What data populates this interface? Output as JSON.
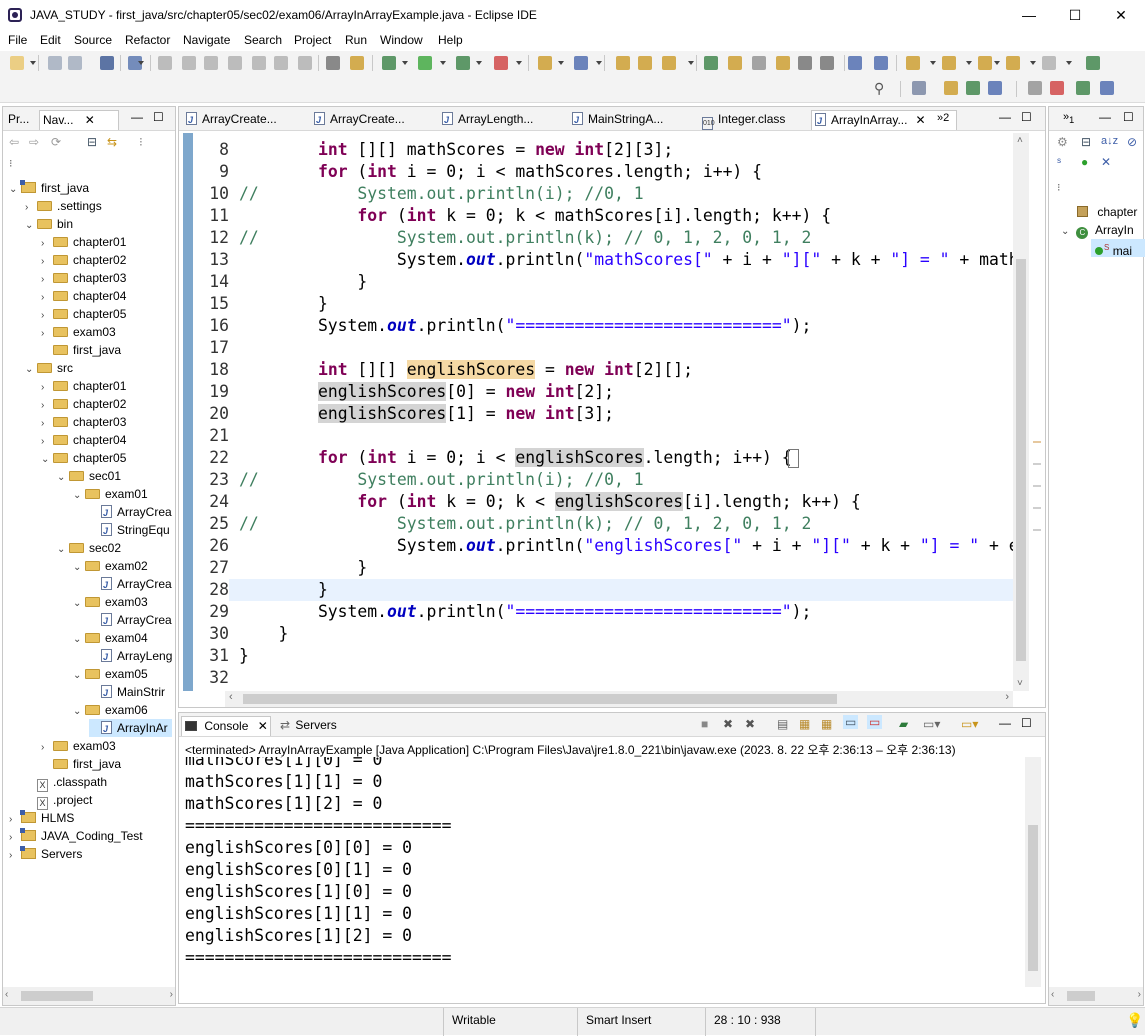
{
  "window": {
    "title": "JAVA_STUDY - first_java/src/chapter05/sec02/exam06/ArrayInArrayExample.java - Eclipse IDE",
    "minimize": "—",
    "maximize": "☐",
    "close": "✕"
  },
  "menu": [
    "File",
    "Edit",
    "Source",
    "Refactor",
    "Navigate",
    "Search",
    "Project",
    "Run",
    "Window",
    "Help"
  ],
  "left_panel": {
    "tabs": [
      {
        "label": "Pr..."
      },
      {
        "label": "Nav..."
      }
    ],
    "tree": [
      {
        "label": "first_java",
        "level": 0,
        "kind": "project",
        "expanded": true
      },
      {
        "label": ".settings",
        "level": 1,
        "kind": "folder",
        "expanded": false
      },
      {
        "label": "bin",
        "level": 1,
        "kind": "folder",
        "expanded": true
      },
      {
        "label": "chapter01",
        "level": 2,
        "kind": "folder",
        "expanded": false
      },
      {
        "label": "chapter02",
        "level": 2,
        "kind": "folder",
        "expanded": false
      },
      {
        "label": "chapter03",
        "level": 2,
        "kind": "folder",
        "expanded": false
      },
      {
        "label": "chapter04",
        "level": 2,
        "kind": "folder",
        "expanded": false
      },
      {
        "label": "chapter05",
        "level": 2,
        "kind": "folder",
        "expanded": false
      },
      {
        "label": "exam03",
        "level": 2,
        "kind": "folder",
        "expanded": false
      },
      {
        "label": "first_java",
        "level": 2,
        "kind": "folder",
        "expanded": null
      },
      {
        "label": "src",
        "level": 1,
        "kind": "folder",
        "expanded": true
      },
      {
        "label": "chapter01",
        "level": 2,
        "kind": "folder",
        "expanded": false
      },
      {
        "label": "chapter02",
        "level": 2,
        "kind": "folder",
        "expanded": false
      },
      {
        "label": "chapter03",
        "level": 2,
        "kind": "folder",
        "expanded": false
      },
      {
        "label": "chapter04",
        "level": 2,
        "kind": "folder",
        "expanded": false
      },
      {
        "label": "chapter05",
        "level": 2,
        "kind": "folder",
        "expanded": true
      },
      {
        "label": "sec01",
        "level": 3,
        "kind": "folder",
        "expanded": true
      },
      {
        "label": "exam01",
        "level": 4,
        "kind": "folder",
        "expanded": true
      },
      {
        "label": "ArrayCrea",
        "level": 5,
        "kind": "file",
        "expanded": null
      },
      {
        "label": "StringEqu",
        "level": 5,
        "kind": "file",
        "expanded": null
      },
      {
        "label": "sec02",
        "level": 3,
        "kind": "folder",
        "expanded": true
      },
      {
        "label": "exam02",
        "level": 4,
        "kind": "folder",
        "expanded": true
      },
      {
        "label": "ArrayCrea",
        "level": 5,
        "kind": "file",
        "expanded": null
      },
      {
        "label": "exam03",
        "level": 4,
        "kind": "folder",
        "expanded": true
      },
      {
        "label": "ArrayCrea",
        "level": 5,
        "kind": "file",
        "expanded": null
      },
      {
        "label": "exam04",
        "level": 4,
        "kind": "folder",
        "expanded": true
      },
      {
        "label": "ArrayLeng",
        "level": 5,
        "kind": "file",
        "expanded": null
      },
      {
        "label": "exam05",
        "level": 4,
        "kind": "folder",
        "expanded": true
      },
      {
        "label": "MainStrir",
        "level": 5,
        "kind": "file",
        "expanded": null
      },
      {
        "label": "exam06",
        "level": 4,
        "kind": "folder",
        "expanded": true
      },
      {
        "label": "ArrayInAr",
        "level": 5,
        "kind": "file",
        "expanded": null,
        "selected": true
      },
      {
        "label": "exam03",
        "level": 2,
        "kind": "folder",
        "expanded": false
      },
      {
        "label": "first_java",
        "level": 2,
        "kind": "folder",
        "expanded": null
      },
      {
        "label": ".classpath",
        "level": 1,
        "kind": "xml",
        "expanded": null
      },
      {
        "label": ".project",
        "level": 1,
        "kind": "xml",
        "expanded": null
      },
      {
        "label": "HLMS",
        "level": 0,
        "kind": "project",
        "expanded": false
      },
      {
        "label": "JAVA_Coding_Test",
        "level": 0,
        "kind": "project",
        "expanded": false
      },
      {
        "label": "Servers",
        "level": 0,
        "kind": "project",
        "expanded": false
      }
    ]
  },
  "editor": {
    "tabs": [
      {
        "label": "ArrayCreate...",
        "active": false
      },
      {
        "label": "ArrayCreate...",
        "active": false
      },
      {
        "label": "ArrayLength...",
        "active": false
      },
      {
        "label": "MainStringA...",
        "active": false
      },
      {
        "label": "Integer.class",
        "active": false
      },
      {
        "label": "ArrayInArray...",
        "active": true
      }
    ],
    "overflow_count": "»2",
    "first_line_number": 8,
    "lines": [
      [
        [
          "        ",
          ""
        ],
        [
          "int",
          "kw"
        ],
        [
          " []",
          ""
        ],
        [
          "[] mathScores = ",
          ""
        ],
        [
          "new",
          "kw"
        ],
        [
          " ",
          ""
        ],
        [
          "int",
          "kw"
        ],
        [
          "[2][3];",
          ""
        ]
      ],
      [
        [
          "        ",
          ""
        ],
        [
          "for",
          "kw"
        ],
        [
          " (",
          ""
        ],
        [
          "int",
          "kw"
        ],
        [
          " i = 0; i < mathScores.length; i++) {",
          ""
        ]
      ],
      [
        [
          "//          System.out.println(i); //0, 1",
          "cm"
        ]
      ],
      [
        [
          "            ",
          ""
        ],
        [
          "for",
          "kw"
        ],
        [
          " (",
          ""
        ],
        [
          "int",
          "kw"
        ],
        [
          " k = 0; k < mathScores[i].length; k++) {",
          ""
        ]
      ],
      [
        [
          "//              System.out.println(k); // 0, 1, 2, 0, 1, 2",
          "cm"
        ]
      ],
      [
        [
          "                System.",
          ""
        ],
        [
          "out",
          "fd"
        ],
        [
          ".println(",
          ""
        ],
        [
          "\"mathScores[\"",
          "st"
        ],
        [
          " + i + ",
          ""
        ],
        [
          "\"][\"",
          "st"
        ],
        [
          " + k + ",
          ""
        ],
        [
          "\"] = \"",
          "st"
        ],
        [
          " + math",
          ""
        ]
      ],
      [
        [
          "            }",
          ""
        ]
      ],
      [
        [
          "        }",
          ""
        ]
      ],
      [
        [
          "        System.",
          ""
        ],
        [
          "out",
          "fd"
        ],
        [
          ".println(",
          ""
        ],
        [
          "\"===========================\"",
          "st"
        ],
        [
          ");",
          ""
        ]
      ],
      [
        [
          "",
          ""
        ]
      ],
      [
        [
          "        ",
          ""
        ],
        [
          "int",
          "kw"
        ],
        [
          " [][] ",
          ""
        ],
        [
          "englishScores",
          "occw"
        ],
        [
          " = ",
          ""
        ],
        [
          "new",
          "kw"
        ],
        [
          " ",
          ""
        ],
        [
          "int",
          "kw"
        ],
        [
          "[2][];",
          ""
        ]
      ],
      [
        [
          "        ",
          ""
        ],
        [
          "englishScores",
          "occ"
        ],
        [
          "[0] = ",
          ""
        ],
        [
          "new",
          "kw"
        ],
        [
          " ",
          ""
        ],
        [
          "int",
          "kw"
        ],
        [
          "[2];",
          ""
        ]
      ],
      [
        [
          "        ",
          ""
        ],
        [
          "englishScores",
          "occ"
        ],
        [
          "[1] = ",
          ""
        ],
        [
          "new",
          "kw"
        ],
        [
          " ",
          ""
        ],
        [
          "int",
          "kw"
        ],
        [
          "[3];",
          ""
        ]
      ],
      [
        [
          "",
          ""
        ]
      ],
      [
        [
          "        ",
          ""
        ],
        [
          "for",
          "kw"
        ],
        [
          " (",
          ""
        ],
        [
          "int",
          "kw"
        ],
        [
          " i = 0; i < ",
          ""
        ],
        [
          "englishScores",
          "occ"
        ],
        [
          ".length; i++) {",
          ""
        ]
      ],
      [
        [
          "//          System.out.println(i); //0, 1",
          "cm"
        ]
      ],
      [
        [
          "            ",
          ""
        ],
        [
          "for",
          "kw"
        ],
        [
          " (",
          ""
        ],
        [
          "int",
          "kw"
        ],
        [
          " k = 0; k < ",
          ""
        ],
        [
          "englishScores",
          "occ"
        ],
        [
          "[i].length; k++) {",
          ""
        ]
      ],
      [
        [
          "//              System.out.println(k); // 0, 1, 2, 0, 1, 2",
          "cm"
        ]
      ],
      [
        [
          "                System.",
          ""
        ],
        [
          "out",
          "fd"
        ],
        [
          ".println(",
          ""
        ],
        [
          "\"englishScores[\"",
          "st"
        ],
        [
          " + i + ",
          ""
        ],
        [
          "\"][\"",
          "st"
        ],
        [
          " + k + ",
          ""
        ],
        [
          "\"] = \"",
          "st"
        ],
        [
          " + e",
          ""
        ]
      ],
      [
        [
          "            }",
          ""
        ]
      ],
      [
        [
          "        }",
          ""
        ]
      ],
      [
        [
          "        System.",
          ""
        ],
        [
          "out",
          "fd"
        ],
        [
          ".println(",
          ""
        ],
        [
          "\"===========================\"",
          "st"
        ],
        [
          ");",
          ""
        ]
      ],
      [
        [
          "    }",
          ""
        ]
      ],
      [
        [
          "}",
          ""
        ]
      ],
      [
        [
          "",
          ""
        ]
      ]
    ],
    "current_line": 28
  },
  "right_panel": {
    "items": [
      {
        "label": "chapter"
      },
      {
        "label": "ArrayIn"
      },
      {
        "label": "mai"
      }
    ]
  },
  "console": {
    "tabs": [
      {
        "label": "Console"
      },
      {
        "label": "Servers"
      }
    ],
    "status": "<terminated> ArrayInArrayExample [Java Application] C:\\Program Files\\Java\\jre1.8.0_221\\bin\\javaw.exe  (2023. 8. 22 오후 2:36:13 – 오후 2:36:13)",
    "output": [
      "mathScores[1][0] = 0",
      "mathScores[1][1] = 0",
      "mathScores[1][2] = 0",
      "===========================",
      "englishScores[0][0] = 0",
      "englishScores[0][1] = 0",
      "englishScores[1][0] = 0",
      "englishScores[1][1] = 0",
      "englishScores[1][2] = 0",
      "==========================="
    ]
  },
  "status_bar": {
    "writable": "Writable",
    "insert_mode": "Smart Insert",
    "position": "28 : 10 : 938"
  },
  "colors": {
    "keyword": "#7f0055",
    "comment": "#3f7f5f",
    "string": "#2a00ff",
    "field": "#0000c0",
    "current_line": "#e8f2fe",
    "selection": "#cce8ff"
  }
}
